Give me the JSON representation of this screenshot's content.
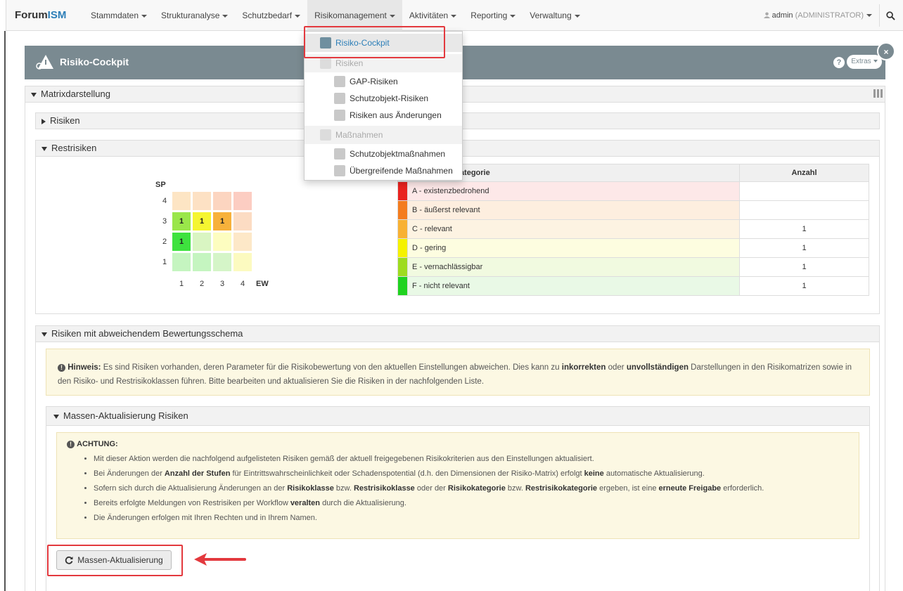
{
  "nav": {
    "brand_a": "Forum",
    "brand_b": "ISM",
    "items": [
      "Stammdaten",
      "Strukturanalyse",
      "Schutzbedarf",
      "Risikomanagement",
      "Aktivitäten",
      "Reporting",
      "Verwaltung"
    ],
    "user": "admin",
    "role": "(ADMINISTRATOR)"
  },
  "dropdown": {
    "risiko_cockpit": "Risiko-Cockpit",
    "risiken_header": "Risiken",
    "gap": "GAP-Risiken",
    "schutzobjekt": "Schutzobjekt-Risiken",
    "aenderungen": "Risiken aus Änderungen",
    "massnahmen_header": "Maßnahmen",
    "so_massnahmen": "Schutzobjektmaßnahmen",
    "uebergreifende": "Übergreifende Maßnahmen"
  },
  "page": {
    "title": "Risiko-Cockpit",
    "help": "?",
    "extras": "Extras",
    "close": "×"
  },
  "panels": {
    "matrix": "Matrixdarstellung",
    "risiken": "Risiken",
    "restrisiken": "Restrisiken",
    "abweichend": "Risiken mit abweichendem Bewertungsschema",
    "massen": "Massen-Aktualisierung Risiken"
  },
  "matrix": {
    "y_label": "SP",
    "x_label": "EW",
    "cells": [
      {
        "row": 3,
        "col": 0,
        "v": ""
      },
      {
        "row": 3,
        "col": 1,
        "v": ""
      },
      {
        "row": 3,
        "col": 2,
        "v": ""
      },
      {
        "row": 3,
        "col": 3,
        "v": ""
      },
      {
        "row": 2,
        "col": 0,
        "v": "1"
      },
      {
        "row": 2,
        "col": 1,
        "v": "1"
      },
      {
        "row": 2,
        "col": 2,
        "v": "1"
      },
      {
        "row": 2,
        "col": 3,
        "v": ""
      },
      {
        "row": 1,
        "col": 0,
        "v": "1"
      },
      {
        "row": 1,
        "col": 1,
        "v": ""
      },
      {
        "row": 1,
        "col": 2,
        "v": ""
      },
      {
        "row": 1,
        "col": 3,
        "v": ""
      },
      {
        "row": 0,
        "col": 0,
        "v": ""
      },
      {
        "row": 0,
        "col": 1,
        "v": ""
      },
      {
        "row": 0,
        "col": 2,
        "v": ""
      },
      {
        "row": 0,
        "col": 3,
        "v": ""
      }
    ],
    "colors": [
      [
        "#fde5c4",
        "#fde1c4",
        "#fcd5c0",
        "#fccdc2"
      ],
      [
        "#9ae64a",
        "#f5f531",
        "#f7b13b",
        "#fcdcc3"
      ],
      [
        "#3ee23e",
        "#d9f5c2",
        "#fdfdc0",
        "#fde8c8"
      ],
      [
        "#c5f5c0",
        "#c5f5c0",
        "#d5f5c8",
        "#fcfac0"
      ]
    ]
  },
  "table": {
    "col_kat": "Kategorie",
    "col_anzahl": "Anzahl",
    "rows": [
      {
        "label": "A - existenzbedrohend",
        "count": "",
        "swatch": "#e9231f",
        "bg": "#fde8e8"
      },
      {
        "label": "B - äußerst relevant",
        "count": "",
        "swatch": "#f47c1e",
        "bg": "#fdeedf"
      },
      {
        "label": "C - relevant",
        "count": "1",
        "swatch": "#f8b133",
        "bg": "#fdf3e2"
      },
      {
        "label": "D - gering",
        "count": "1",
        "swatch": "#f5f200",
        "bg": "#fdfde0"
      },
      {
        "label": "E - vernachlässigbar",
        "count": "1",
        "swatch": "#9edc1e",
        "bg": "#f1fae0"
      },
      {
        "label": "F - nicht relevant",
        "count": "1",
        "swatch": "#1fd31f",
        "bg": "#e9f9e6"
      }
    ]
  },
  "hinweis": {
    "label": "Hinweis:",
    "t1": " Es sind Risiken vorhanden, deren Parameter für die Risikobewertung von den aktuellen Einstellungen abweichen. Dies kann zu ",
    "b1": "inkorrekten",
    "t2": " oder ",
    "b2": "unvollständigen",
    "t3": " Darstellungen in den Risikomatrizen sowie in den Risiko- und Restrisikoklassen führen. Bitte bearbeiten und aktualisieren Sie die Risiken in der nachfolgenden Liste."
  },
  "achtung": {
    "label": "ACHTUNG:",
    "l1": "Mit dieser Aktion werden die nachfolgend aufgelisteten Risiken gemäß der aktuell freigegebenen Risikokriterien aus den Einstellungen aktualisiert.",
    "l2a": "Bei Änderungen der ",
    "l2b": "Anzahl der Stufen",
    "l2c": " für Eintrittswahrscheinlichkeit oder Schadenspotential (d.h. den Dimensionen der Risiko-Matrix) erfolgt ",
    "l2d": "keine",
    "l2e": " automatische Aktualisierung.",
    "l3a": "Sofern sich durch die Aktualisierung Änderungen an der ",
    "l3b": "Risikoklasse",
    "l3c": " bzw. ",
    "l3d": "Restrisikoklasse",
    "l3e": " oder der ",
    "l3f": "Risikokategorie",
    "l3g": " bzw. ",
    "l3h": "Restrisikokategorie",
    "l3i": " ergeben, ist eine ",
    "l3j": "erneute Freigabe",
    "l3k": " erforderlich.",
    "l4a": "Bereits erfolgte Meldungen von Restrisiken per Workflow ",
    "l4b": "veralten",
    "l4c": " durch die Aktualisierung.",
    "l5": "Die Änderungen erfolgen mit Ihren Rechten und in Ihrem Namen."
  },
  "button": {
    "label": "Massen-Aktualisierung"
  }
}
